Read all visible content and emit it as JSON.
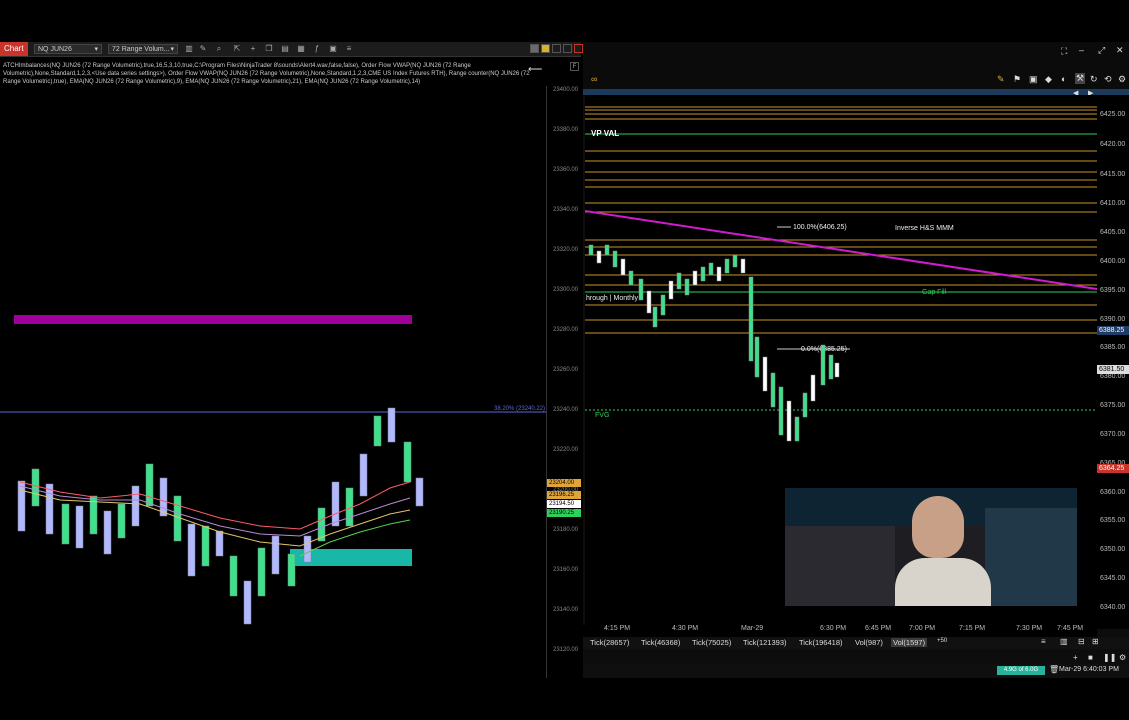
{
  "left": {
    "tab_label": "Chart",
    "instrument": "NQ JUN26",
    "timeframe": "72 Range Volum...",
    "indicators_text": "ATCHImbalances(NQ JUN26 (72 Range Volumetric),true,16,5,3,10,true,C:\\Program Files\\NinjaTrader 8\\sounds\\Alert4.wav,false,false), Order Flow VWAP(NQ JUN26 (72 Range Volumetric),None,Standard,1,2,3,<Use data series settings>), Order Flow VWAP(NQ JUN26 (72 Range Volumetric),None,Standard,1,2,3,CME US Index Futures RTH), Range counter(NQ JUN26 (72 Range Volumetric),true), EMA(NQ JUN26 (72 Range Volumetric),9), EMA(NQ JUN26 (72 Range Volumetric),21), EMA(NQ JUN26 (72 Range Volumetric),14)",
    "fib_label": "38.20% (23240.22)",
    "price_ticks": [
      "23400.00",
      "23380.00",
      "23360.00",
      "23340.00",
      "23320.00",
      "23300.00",
      "23280.00",
      "23260.00",
      "23240.00",
      "23220.00",
      "23200.00",
      "23180.00",
      "23160.00",
      "23140.00",
      "23120.00"
    ],
    "tags": [
      "23204.00",
      "23196.25",
      "23194.50",
      "23190.25"
    ]
  },
  "right": {
    "labels": {
      "vp_val": "VP VAL",
      "fib_100": "100.0%(6406.25)",
      "inverse_hs": "Inverse H&S MMM",
      "gap_fill": "Gap Fill",
      "monthly": "hrough | Monthly",
      "fib_0": "0.0%(6385.25)",
      "fvg": "FVG"
    },
    "price_ticks": [
      "6425.00",
      "6420.00",
      "6415.00",
      "6410.00",
      "6405.00",
      "6400.00",
      "6395.00",
      "6390.00",
      "6385.00",
      "6380.00",
      "6375.00",
      "6370.00",
      "6365.00",
      "6360.00",
      "6355.00",
      "6350.00",
      "6345.00",
      "6340.00"
    ],
    "price_tags": [
      "6388.25",
      "6381.50",
      "6364.25"
    ],
    "time_ticks": [
      "4:15 PM",
      "4:30 PM",
      "Mar-29",
      "6:30 PM",
      "6:45 PM",
      "7:00 PM",
      "7:15 PM",
      "7:30 PM",
      "7:45 PM"
    ],
    "tabs": [
      "Tick(28657)",
      "Tick(46368)",
      "Tick(75025)",
      "Tick(121393)",
      "Tick(196418)",
      "Vol(987)",
      "Vol(1597)",
      "+50"
    ],
    "status_badge": "4.9G of 6.0G",
    "datetime": "Mar-29 6:40:03 PM"
  },
  "colors": {
    "chart_tab": "#c8332a",
    "magenta_zone": "#a0009a",
    "teal_zone": "#19b7a8",
    "level_gold": "#c8952a",
    "level_green": "#2fd05a",
    "trendline": "#d21bd0",
    "candle_up": "#3ee08c",
    "candle_down": "#ffffff"
  }
}
